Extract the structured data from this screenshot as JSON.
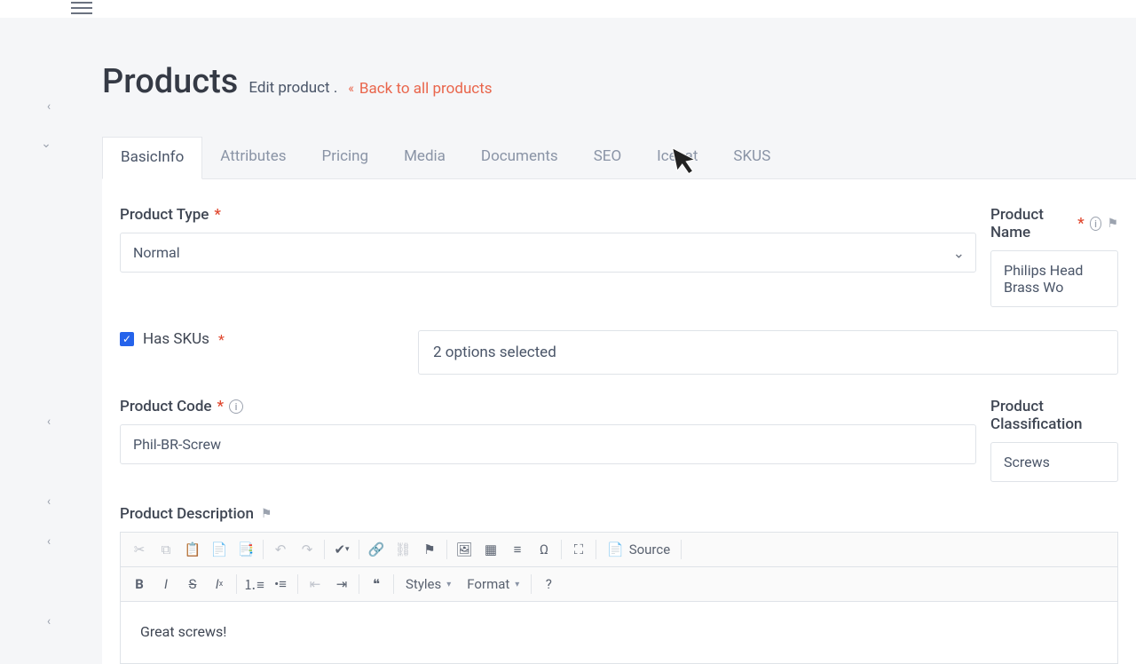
{
  "header": {
    "title": "Products",
    "subtitle": "Edit product .",
    "back_link": "Back to all products"
  },
  "tabs": [
    {
      "key": "basic",
      "label": "BasicInfo",
      "active": true
    },
    {
      "key": "attributes",
      "label": "Attributes"
    },
    {
      "key": "pricing",
      "label": "Pricing"
    },
    {
      "key": "media",
      "label": "Media"
    },
    {
      "key": "documents",
      "label": "Documents"
    },
    {
      "key": "seo",
      "label": "SEO"
    },
    {
      "key": "icecat",
      "label": "Icecat"
    },
    {
      "key": "skus",
      "label": "SKUS"
    }
  ],
  "form": {
    "product_type": {
      "label": "Product Type",
      "value": "Normal"
    },
    "product_name": {
      "label": "Product Name",
      "value": "Philips Head Brass Wo"
    },
    "has_skus": {
      "label": "Has SKUs",
      "checked": true
    },
    "sku_options": {
      "summary": "2 options selected"
    },
    "product_code": {
      "label": "Product Code",
      "value": "Phil-BR-Screw"
    },
    "product_classification": {
      "label": "Product Classification",
      "value": "Screws"
    },
    "description": {
      "label": "Product Description",
      "content": "Great screws!"
    }
  },
  "editor_toolbar": {
    "styles": "Styles",
    "format": "Format",
    "source": "Source"
  }
}
